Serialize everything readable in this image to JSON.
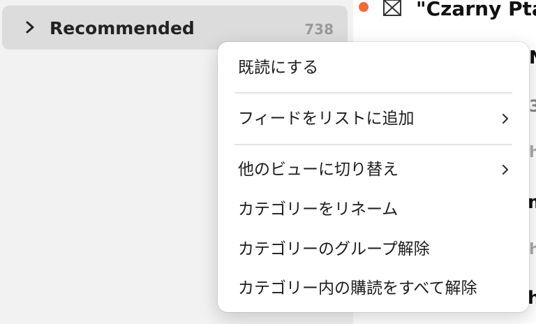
{
  "sidebar": {
    "category": {
      "label": "Recommended",
      "count": "738"
    }
  },
  "content": {
    "unread_color": "#f26a3a",
    "article_title": "\"Czarny Ptak",
    "peeks": [
      "N",
      "3",
      "h",
      "m",
      "h",
      "h"
    ]
  },
  "context_menu": {
    "items": [
      {
        "label": "既読にする",
        "submenu": false
      },
      {
        "label": "フィードをリストに追加",
        "submenu": true
      },
      {
        "label": "他のビューに切り替え",
        "submenu": true
      },
      {
        "label": "カテゴリーをリネーム",
        "submenu": false
      },
      {
        "label": "カテゴリーのグループ解除",
        "submenu": false
      },
      {
        "label": "カテゴリー内の購読をすべて解除",
        "submenu": false
      }
    ]
  }
}
